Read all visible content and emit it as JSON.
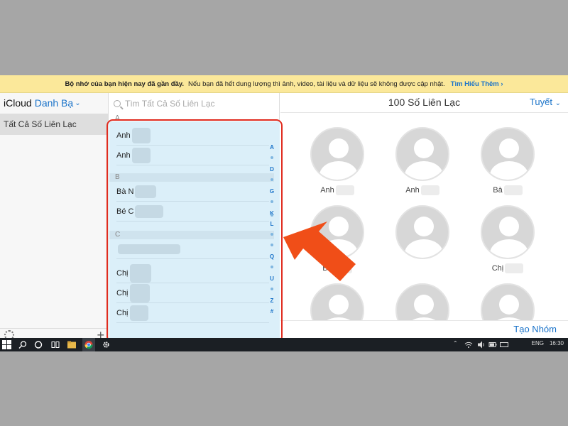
{
  "banner": {
    "bold_text": "Bộ nhớ của bạn hiện nay đã gần đầy.",
    "text": "Nếu bạn đã hết dung lượng thì ảnh, video, tài liệu và dữ liệu sẽ không được cập nhật.",
    "link": "Tìm Hiểu Thêm ›"
  },
  "sidebar": {
    "brand": "iCloud",
    "app_name": "Danh Bạ",
    "chevron": "⌄",
    "all_contacts": "Tất Cả Số Liên Lạc",
    "footer_icons": [
      "gear-icon",
      "plus-icon"
    ]
  },
  "list": {
    "search_placeholder": "Tìm Tất Cả Số Liên Lạc",
    "sections": [
      {
        "letter": "A",
        "rows": [
          "Anh",
          "Anh"
        ]
      },
      {
        "letter": "B",
        "rows": [
          "Bà N",
          "Bé C"
        ]
      },
      {
        "letter": "C",
        "rows": [
          "",
          "Chị",
          "Chị",
          "Chị"
        ]
      }
    ],
    "index_letters": [
      "A",
      "D",
      "G",
      "K",
      "L",
      "Q",
      "U",
      "Z",
      "#"
    ]
  },
  "cards": {
    "title": "100 Số Liên Lạc",
    "select_label": "Tuyết",
    "names": [
      "Anh",
      "Anh",
      "Bà",
      "Bé",
      "",
      "Chị",
      "",
      "",
      ""
    ],
    "new_group": "Tạo Nhóm"
  },
  "taskbar": {
    "tray_text": "ENG",
    "clock": "16:30"
  },
  "colors": {
    "accent": "#1a73c9",
    "banner_bg": "#fbe89a",
    "highlight": "#dbeff9",
    "annotation_red": "#e02c1f",
    "arrow": "#f04e18"
  }
}
